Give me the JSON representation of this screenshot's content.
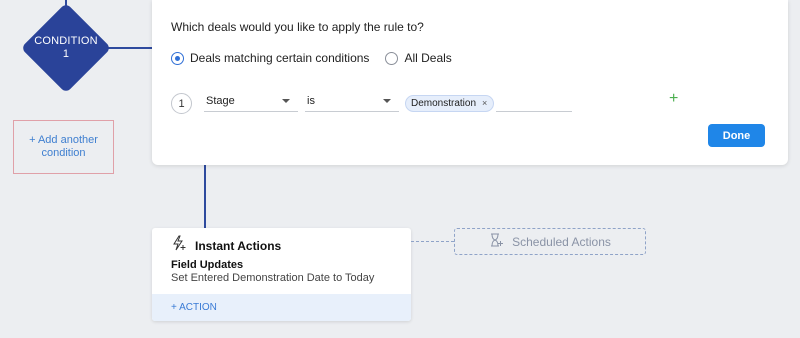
{
  "condition": {
    "label": "CONDITION",
    "number": "1"
  },
  "add_condition": {
    "line1": "+ Add another",
    "line2": "condition"
  },
  "rule": {
    "question": "Which deals would you like to apply the rule to?",
    "options": [
      {
        "label": "Deals matching certain conditions",
        "checked": true
      },
      {
        "label": "All Deals",
        "checked": false
      }
    ],
    "criteria": {
      "index": "1",
      "field": "Stage",
      "operator": "is",
      "value_chip": "Demonstration",
      "value_input": ""
    },
    "done_label": "Done"
  },
  "instant": {
    "title": "Instant Actions",
    "item_title": "Field Updates",
    "item_desc": "Set Entered Demonstration Date to Today",
    "add_action": "+ ACTION"
  },
  "scheduled": {
    "label": "Scheduled Actions"
  },
  "colors": {
    "accent": "#1f86e8",
    "diamond": "#2a4399",
    "connector": "#2e4a9e"
  }
}
